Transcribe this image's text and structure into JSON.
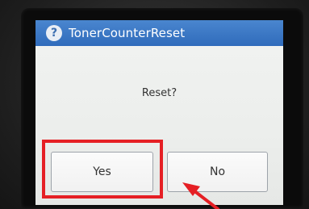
{
  "dialog": {
    "title": "TonerCounterReset",
    "help_icon_glyph": "?",
    "message": "Reset?",
    "yes_label": "Yes",
    "no_label": "No"
  },
  "annotation": {
    "highlight_color": "#e51f24",
    "titlebar_color": "#3b78c4"
  }
}
